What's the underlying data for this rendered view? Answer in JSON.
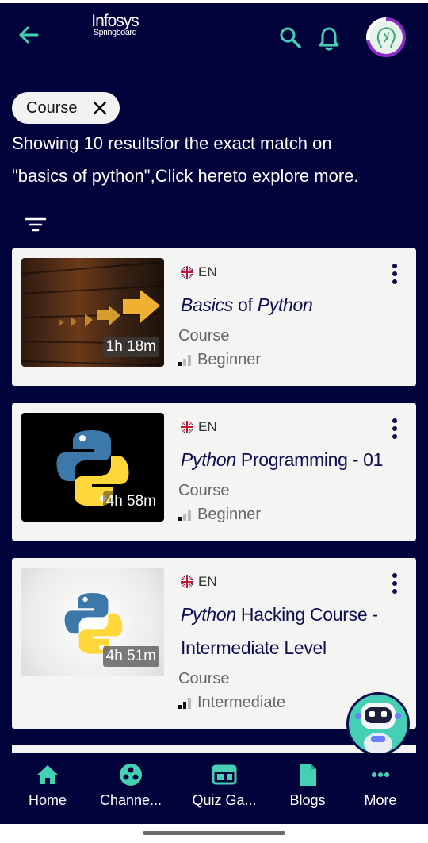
{
  "header": {
    "logo_line1": "Infosys",
    "logo_line2": "Springboard",
    "accent_color": "#45d0b6"
  },
  "filter_chip": {
    "label": "Course"
  },
  "results": {
    "line1": "Showing 10 resultsfor the exact match on",
    "line2": "\"basics of python\",Click hereto explore more."
  },
  "courses": [
    {
      "language": "EN",
      "title_em": "Basics",
      "title_rest": " of ",
      "title_em2": "Python",
      "title_line2": "",
      "duration": "1h 18m",
      "type": "Course",
      "level": "Beginner",
      "level_bars": 1
    },
    {
      "language": "EN",
      "title_em": "Python",
      "title_rest": " Programming - 01",
      "title_em2": "",
      "title_line2": "",
      "duration": "4h 58m",
      "type": "Course",
      "level": "Beginner",
      "level_bars": 1
    },
    {
      "language": "EN",
      "title_em": "Python",
      "title_rest": " Hacking Course -",
      "title_em2": "",
      "title_line2": "Intermediate Level",
      "duration": "4h 51m",
      "type": "Course",
      "level": "Intermediate",
      "level_bars": 2
    }
  ],
  "nav": [
    {
      "label": "Home",
      "icon": "home-icon"
    },
    {
      "label": "Channe...",
      "icon": "channels-icon"
    },
    {
      "label": "Quiz Ga...",
      "icon": "quiz-games-icon"
    },
    {
      "label": "Blogs",
      "icon": "blogs-icon"
    },
    {
      "label": "More",
      "icon": "more-icon"
    }
  ]
}
